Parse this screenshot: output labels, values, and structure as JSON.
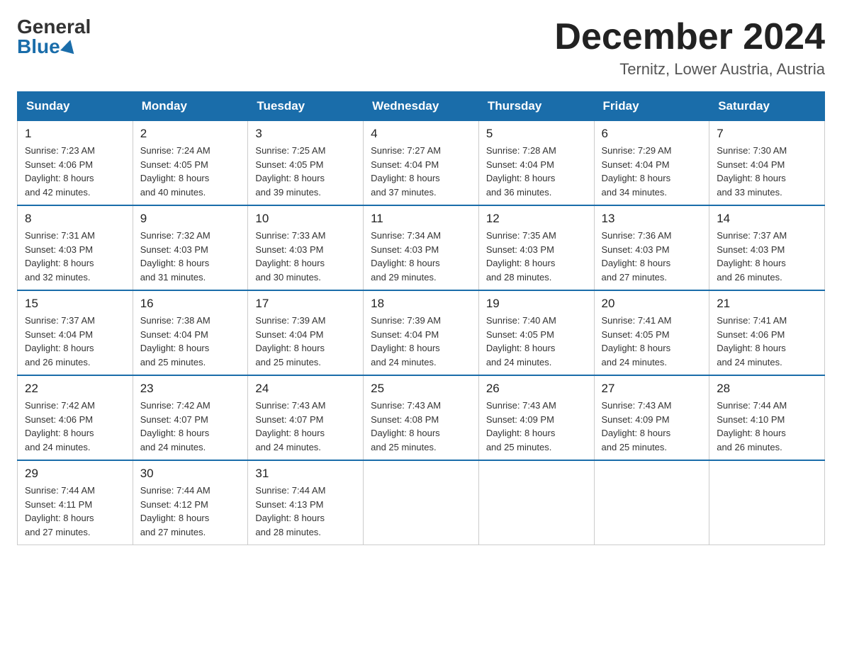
{
  "header": {
    "logo_general": "General",
    "logo_blue": "Blue",
    "month_title": "December 2024",
    "location": "Ternitz, Lower Austria, Austria"
  },
  "days_of_week": [
    "Sunday",
    "Monday",
    "Tuesday",
    "Wednesday",
    "Thursday",
    "Friday",
    "Saturday"
  ],
  "weeks": [
    [
      {
        "day": "1",
        "sunrise": "7:23 AM",
        "sunset": "4:06 PM",
        "daylight": "8 hours and 42 minutes."
      },
      {
        "day": "2",
        "sunrise": "7:24 AM",
        "sunset": "4:05 PM",
        "daylight": "8 hours and 40 minutes."
      },
      {
        "day": "3",
        "sunrise": "7:25 AM",
        "sunset": "4:05 PM",
        "daylight": "8 hours and 39 minutes."
      },
      {
        "day": "4",
        "sunrise": "7:27 AM",
        "sunset": "4:04 PM",
        "daylight": "8 hours and 37 minutes."
      },
      {
        "day": "5",
        "sunrise": "7:28 AM",
        "sunset": "4:04 PM",
        "daylight": "8 hours and 36 minutes."
      },
      {
        "day": "6",
        "sunrise": "7:29 AM",
        "sunset": "4:04 PM",
        "daylight": "8 hours and 34 minutes."
      },
      {
        "day": "7",
        "sunrise": "7:30 AM",
        "sunset": "4:04 PM",
        "daylight": "8 hours and 33 minutes."
      }
    ],
    [
      {
        "day": "8",
        "sunrise": "7:31 AM",
        "sunset": "4:03 PM",
        "daylight": "8 hours and 32 minutes."
      },
      {
        "day": "9",
        "sunrise": "7:32 AM",
        "sunset": "4:03 PM",
        "daylight": "8 hours and 31 minutes."
      },
      {
        "day": "10",
        "sunrise": "7:33 AM",
        "sunset": "4:03 PM",
        "daylight": "8 hours and 30 minutes."
      },
      {
        "day": "11",
        "sunrise": "7:34 AM",
        "sunset": "4:03 PM",
        "daylight": "8 hours and 29 minutes."
      },
      {
        "day": "12",
        "sunrise": "7:35 AM",
        "sunset": "4:03 PM",
        "daylight": "8 hours and 28 minutes."
      },
      {
        "day": "13",
        "sunrise": "7:36 AM",
        "sunset": "4:03 PM",
        "daylight": "8 hours and 27 minutes."
      },
      {
        "day": "14",
        "sunrise": "7:37 AM",
        "sunset": "4:03 PM",
        "daylight": "8 hours and 26 minutes."
      }
    ],
    [
      {
        "day": "15",
        "sunrise": "7:37 AM",
        "sunset": "4:04 PM",
        "daylight": "8 hours and 26 minutes."
      },
      {
        "day": "16",
        "sunrise": "7:38 AM",
        "sunset": "4:04 PM",
        "daylight": "8 hours and 25 minutes."
      },
      {
        "day": "17",
        "sunrise": "7:39 AM",
        "sunset": "4:04 PM",
        "daylight": "8 hours and 25 minutes."
      },
      {
        "day": "18",
        "sunrise": "7:39 AM",
        "sunset": "4:04 PM",
        "daylight": "8 hours and 24 minutes."
      },
      {
        "day": "19",
        "sunrise": "7:40 AM",
        "sunset": "4:05 PM",
        "daylight": "8 hours and 24 minutes."
      },
      {
        "day": "20",
        "sunrise": "7:41 AM",
        "sunset": "4:05 PM",
        "daylight": "8 hours and 24 minutes."
      },
      {
        "day": "21",
        "sunrise": "7:41 AM",
        "sunset": "4:06 PM",
        "daylight": "8 hours and 24 minutes."
      }
    ],
    [
      {
        "day": "22",
        "sunrise": "7:42 AM",
        "sunset": "4:06 PM",
        "daylight": "8 hours and 24 minutes."
      },
      {
        "day": "23",
        "sunrise": "7:42 AM",
        "sunset": "4:07 PM",
        "daylight": "8 hours and 24 minutes."
      },
      {
        "day": "24",
        "sunrise": "7:43 AM",
        "sunset": "4:07 PM",
        "daylight": "8 hours and 24 minutes."
      },
      {
        "day": "25",
        "sunrise": "7:43 AM",
        "sunset": "4:08 PM",
        "daylight": "8 hours and 25 minutes."
      },
      {
        "day": "26",
        "sunrise": "7:43 AM",
        "sunset": "4:09 PM",
        "daylight": "8 hours and 25 minutes."
      },
      {
        "day": "27",
        "sunrise": "7:43 AM",
        "sunset": "4:09 PM",
        "daylight": "8 hours and 25 minutes."
      },
      {
        "day": "28",
        "sunrise": "7:44 AM",
        "sunset": "4:10 PM",
        "daylight": "8 hours and 26 minutes."
      }
    ],
    [
      {
        "day": "29",
        "sunrise": "7:44 AM",
        "sunset": "4:11 PM",
        "daylight": "8 hours and 27 minutes."
      },
      {
        "day": "30",
        "sunrise": "7:44 AM",
        "sunset": "4:12 PM",
        "daylight": "8 hours and 27 minutes."
      },
      {
        "day": "31",
        "sunrise": "7:44 AM",
        "sunset": "4:13 PM",
        "daylight": "8 hours and 28 minutes."
      },
      null,
      null,
      null,
      null
    ]
  ],
  "labels": {
    "sunrise": "Sunrise:",
    "sunset": "Sunset:",
    "daylight": "Daylight:"
  }
}
